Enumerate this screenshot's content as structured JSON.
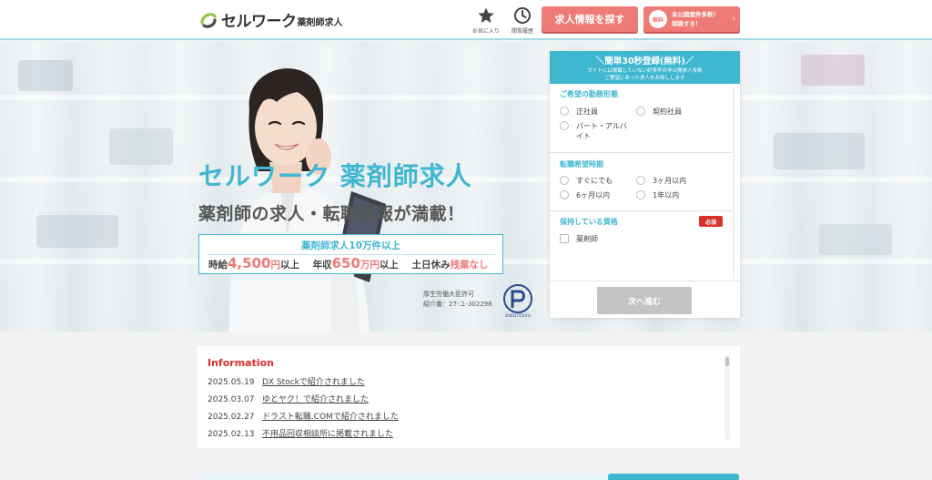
{
  "header": {
    "logo_main": "セルワーク",
    "logo_sub": "薬剤師求人",
    "favorites_label": "お気に入り",
    "history_label": "閲覧履歴",
    "search_button": "求人情報を探す",
    "secret_badge": "無料",
    "secret_line1": "未公開案件多数！",
    "secret_line2": "相談する！",
    "secret_chevron": "›"
  },
  "hero": {
    "title": "セルワーク 薬剤師求人",
    "subtitle": "薬剤師の求人・転職情報が満載！",
    "box_top": "薬剤師求人10万件以上",
    "hourly_prefix": "時給",
    "hourly_value": "4,500",
    "hourly_unit": "円",
    "hourly_suffix": "以上",
    "annual_prefix": "年収",
    "annual_value": "650",
    "annual_unit": "万円",
    "annual_suffix": "以上",
    "holiday_prefix": "土日休み",
    "holiday_highlight": "残業なし",
    "license_line1": "厚生労働大臣許可",
    "license_line2": "紹介番：27-ユ-302296",
    "pmark_code": "20002755(01)"
  },
  "form": {
    "head_title": "＼簡単30秒登録(無料)／",
    "head_line1": "サイトには掲載していない好条件の非公開求人多数",
    "head_line2": "ご要望にあった求人をお探しします",
    "required": "必須",
    "section1": {
      "label": "ご希望の勤務形態",
      "options": [
        "正社員",
        "契約社員",
        "パート・アルバ",
        "イト"
      ]
    },
    "section2": {
      "label": "転職希望時期",
      "options": [
        "すぐにでも",
        "3ヶ月以内",
        "6ヶ月以内",
        "1年以内"
      ]
    },
    "section3": {
      "label": "保持している資格",
      "options": [
        "薬剤師"
      ]
    },
    "next_button": "次へ進む"
  },
  "info": {
    "title": "Information",
    "items": [
      {
        "date": "2025.05.19",
        "text": "DX Stockで紹介されました"
      },
      {
        "date": "2025.03.07",
        "text": "ゆとヤク！で紹介されました"
      },
      {
        "date": "2025.02.27",
        "text": "ドラスト転職.COMで紹介されました"
      },
      {
        "date": "2025.02.13",
        "text": "不用品回収相談所に掲載されました"
      }
    ]
  },
  "colors": {
    "accent": "#3fb7d1",
    "cta": "#ee7b76",
    "required": "#d9302c"
  }
}
